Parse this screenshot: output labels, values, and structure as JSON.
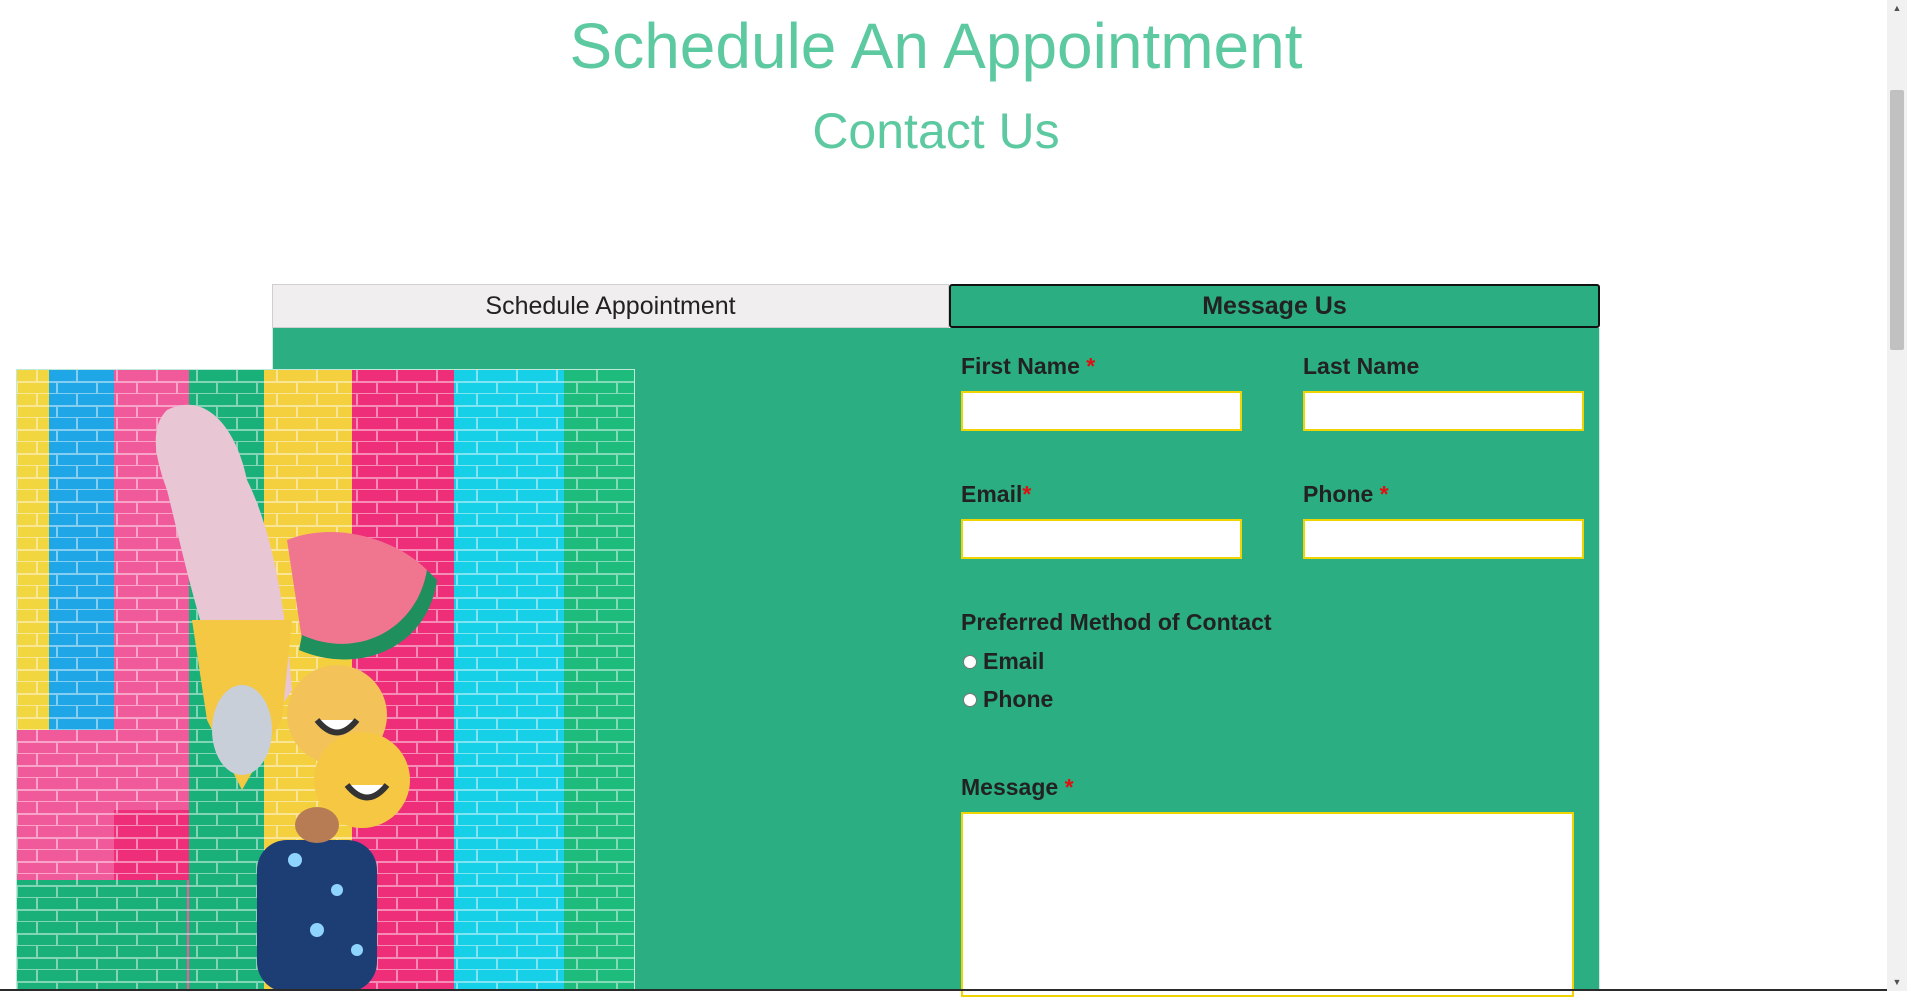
{
  "colors": {
    "accent": "#2bae82",
    "accent_text": "#5cc9a0",
    "field_border": "#f0d400",
    "required": "#e01010"
  },
  "header": {
    "title": "Schedule An Appointment",
    "subtitle": "Contact Us"
  },
  "tabs": [
    {
      "label": "Schedule Appointment",
      "active": false
    },
    {
      "label": "Message Us",
      "active": true
    }
  ],
  "form": {
    "first_name": {
      "label": "First Name",
      "required_mark": "*",
      "value": ""
    },
    "last_name": {
      "label": "Last Name",
      "value": ""
    },
    "email": {
      "label": "Email",
      "required_mark": "*",
      "value": ""
    },
    "phone": {
      "label": "Phone",
      "required_mark": "*",
      "value": ""
    },
    "contact_method": {
      "label": "Preferred Method of Contact",
      "options": [
        "Email",
        "Phone"
      ],
      "selected": null
    },
    "message": {
      "label": "Message",
      "required_mark": "*",
      "value": ""
    }
  },
  "image": {
    "icon": "photo-balloons-colorful-brick-wall"
  },
  "scrollbar": {
    "up_icon": "▲",
    "down_icon": "▼"
  }
}
